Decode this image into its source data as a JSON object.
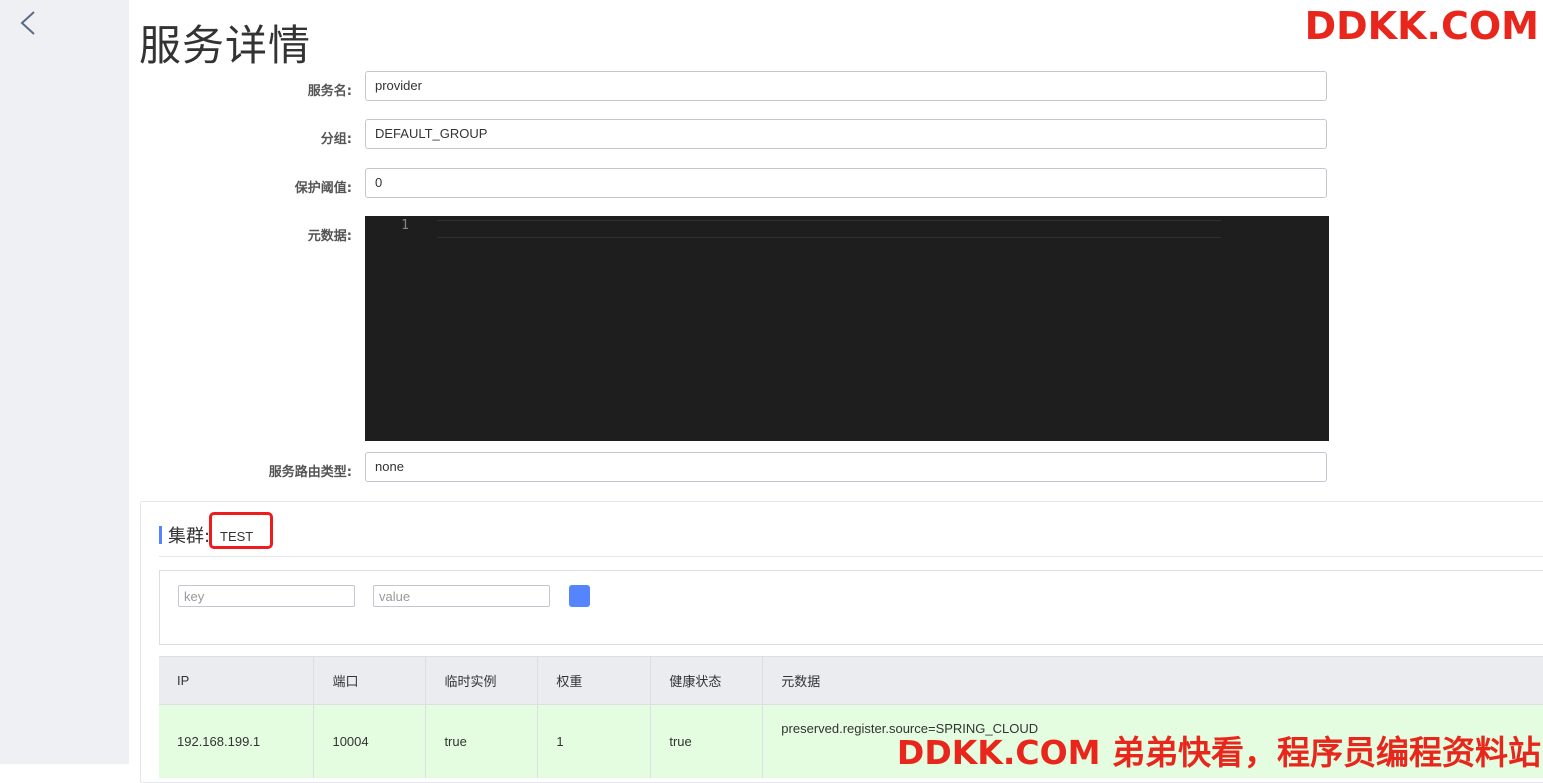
{
  "page_title": "服务详情",
  "watermark_top": "DDKK.COM",
  "watermark_bottom": "DDKK.COM 弟弟快看，程序员编程资料站",
  "icons": {
    "back": "chevron-left-icon"
  },
  "form": {
    "service_name": {
      "label": "服务名:",
      "value": "provider"
    },
    "group": {
      "label": "分组:",
      "value": "DEFAULT_GROUP"
    },
    "protect_threshold": {
      "label": "保护阈值:",
      "value": "0"
    },
    "metadata": {
      "label": "元数据:",
      "line_number": "1"
    },
    "selector_type": {
      "label": "服务路由类型:",
      "value": "none"
    }
  },
  "cluster": {
    "title": "集群:",
    "name": "TEST",
    "filter": {
      "key_placeholder": "key",
      "value_placeholder": "value"
    },
    "table": {
      "headers": [
        "IP",
        "端口",
        "临时实例",
        "权重",
        "健康状态",
        "元数据"
      ],
      "rows": [
        {
          "ip": "192.168.199.1",
          "port": "10004",
          "ephemeral": "true",
          "weight": "1",
          "healthy": "true",
          "metadata": "preserved.register.source=SPRING_CLOUD"
        }
      ]
    }
  },
  "colors": {
    "accent": "#5584ff",
    "highlight_box": "#ee1c1c",
    "watermark": "#e8261b",
    "row_healthy_bg": "#e4fde0",
    "editor_bg": "#1e1e1e"
  }
}
